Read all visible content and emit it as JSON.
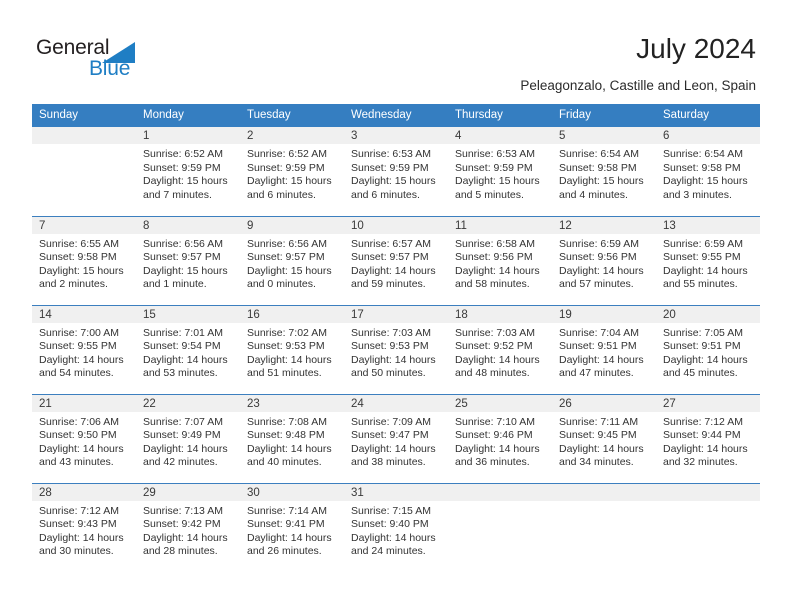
{
  "logo": {
    "word_one": "General",
    "word_two": "Blue",
    "triangle_color": "#1f7ec4"
  },
  "header": {
    "title": "July 2024",
    "subtitle": "Peleagonzalo, Castille and Leon, Spain"
  },
  "colors": {
    "header_bar": "#357ec1",
    "daynum_band": "#f0f0f0",
    "row_divider": "#3c7fbf",
    "text": "#333333"
  },
  "calendar": {
    "weekday_headers": [
      "Sunday",
      "Monday",
      "Tuesday",
      "Wednesday",
      "Thursday",
      "Friday",
      "Saturday"
    ],
    "weeks": [
      [
        {
          "day": "",
          "blank": true,
          "sunrise": "",
          "sunset": "",
          "daylight_line1": "",
          "daylight_line2": ""
        },
        {
          "day": "1",
          "sunrise": "Sunrise: 6:52 AM",
          "sunset": "Sunset: 9:59 PM",
          "daylight_line1": "Daylight: 15 hours",
          "daylight_line2": "and 7 minutes."
        },
        {
          "day": "2",
          "sunrise": "Sunrise: 6:52 AM",
          "sunset": "Sunset: 9:59 PM",
          "daylight_line1": "Daylight: 15 hours",
          "daylight_line2": "and 6 minutes."
        },
        {
          "day": "3",
          "sunrise": "Sunrise: 6:53 AM",
          "sunset": "Sunset: 9:59 PM",
          "daylight_line1": "Daylight: 15 hours",
          "daylight_line2": "and 6 minutes."
        },
        {
          "day": "4",
          "sunrise": "Sunrise: 6:53 AM",
          "sunset": "Sunset: 9:59 PM",
          "daylight_line1": "Daylight: 15 hours",
          "daylight_line2": "and 5 minutes."
        },
        {
          "day": "5",
          "sunrise": "Sunrise: 6:54 AM",
          "sunset": "Sunset: 9:58 PM",
          "daylight_line1": "Daylight: 15 hours",
          "daylight_line2": "and 4 minutes."
        },
        {
          "day": "6",
          "sunrise": "Sunrise: 6:54 AM",
          "sunset": "Sunset: 9:58 PM",
          "daylight_line1": "Daylight: 15 hours",
          "daylight_line2": "and 3 minutes."
        }
      ],
      [
        {
          "day": "7",
          "sunrise": "Sunrise: 6:55 AM",
          "sunset": "Sunset: 9:58 PM",
          "daylight_line1": "Daylight: 15 hours",
          "daylight_line2": "and 2 minutes."
        },
        {
          "day": "8",
          "sunrise": "Sunrise: 6:56 AM",
          "sunset": "Sunset: 9:57 PM",
          "daylight_line1": "Daylight: 15 hours",
          "daylight_line2": "and 1 minute."
        },
        {
          "day": "9",
          "sunrise": "Sunrise: 6:56 AM",
          "sunset": "Sunset: 9:57 PM",
          "daylight_line1": "Daylight: 15 hours",
          "daylight_line2": "and 0 minutes."
        },
        {
          "day": "10",
          "sunrise": "Sunrise: 6:57 AM",
          "sunset": "Sunset: 9:57 PM",
          "daylight_line1": "Daylight: 14 hours",
          "daylight_line2": "and 59 minutes."
        },
        {
          "day": "11",
          "sunrise": "Sunrise: 6:58 AM",
          "sunset": "Sunset: 9:56 PM",
          "daylight_line1": "Daylight: 14 hours",
          "daylight_line2": "and 58 minutes."
        },
        {
          "day": "12",
          "sunrise": "Sunrise: 6:59 AM",
          "sunset": "Sunset: 9:56 PM",
          "daylight_line1": "Daylight: 14 hours",
          "daylight_line2": "and 57 minutes."
        },
        {
          "day": "13",
          "sunrise": "Sunrise: 6:59 AM",
          "sunset": "Sunset: 9:55 PM",
          "daylight_line1": "Daylight: 14 hours",
          "daylight_line2": "and 55 minutes."
        }
      ],
      [
        {
          "day": "14",
          "sunrise": "Sunrise: 7:00 AM",
          "sunset": "Sunset: 9:55 PM",
          "daylight_line1": "Daylight: 14 hours",
          "daylight_line2": "and 54 minutes."
        },
        {
          "day": "15",
          "sunrise": "Sunrise: 7:01 AM",
          "sunset": "Sunset: 9:54 PM",
          "daylight_line1": "Daylight: 14 hours",
          "daylight_line2": "and 53 minutes."
        },
        {
          "day": "16",
          "sunrise": "Sunrise: 7:02 AM",
          "sunset": "Sunset: 9:53 PM",
          "daylight_line1": "Daylight: 14 hours",
          "daylight_line2": "and 51 minutes."
        },
        {
          "day": "17",
          "sunrise": "Sunrise: 7:03 AM",
          "sunset": "Sunset: 9:53 PM",
          "daylight_line1": "Daylight: 14 hours",
          "daylight_line2": "and 50 minutes."
        },
        {
          "day": "18",
          "sunrise": "Sunrise: 7:03 AM",
          "sunset": "Sunset: 9:52 PM",
          "daylight_line1": "Daylight: 14 hours",
          "daylight_line2": "and 48 minutes."
        },
        {
          "day": "19",
          "sunrise": "Sunrise: 7:04 AM",
          "sunset": "Sunset: 9:51 PM",
          "daylight_line1": "Daylight: 14 hours",
          "daylight_line2": "and 47 minutes."
        },
        {
          "day": "20",
          "sunrise": "Sunrise: 7:05 AM",
          "sunset": "Sunset: 9:51 PM",
          "daylight_line1": "Daylight: 14 hours",
          "daylight_line2": "and 45 minutes."
        }
      ],
      [
        {
          "day": "21",
          "sunrise": "Sunrise: 7:06 AM",
          "sunset": "Sunset: 9:50 PM",
          "daylight_line1": "Daylight: 14 hours",
          "daylight_line2": "and 43 minutes."
        },
        {
          "day": "22",
          "sunrise": "Sunrise: 7:07 AM",
          "sunset": "Sunset: 9:49 PM",
          "daylight_line1": "Daylight: 14 hours",
          "daylight_line2": "and 42 minutes."
        },
        {
          "day": "23",
          "sunrise": "Sunrise: 7:08 AM",
          "sunset": "Sunset: 9:48 PM",
          "daylight_line1": "Daylight: 14 hours",
          "daylight_line2": "and 40 minutes."
        },
        {
          "day": "24",
          "sunrise": "Sunrise: 7:09 AM",
          "sunset": "Sunset: 9:47 PM",
          "daylight_line1": "Daylight: 14 hours",
          "daylight_line2": "and 38 minutes."
        },
        {
          "day": "25",
          "sunrise": "Sunrise: 7:10 AM",
          "sunset": "Sunset: 9:46 PM",
          "daylight_line1": "Daylight: 14 hours",
          "daylight_line2": "and 36 minutes."
        },
        {
          "day": "26",
          "sunrise": "Sunrise: 7:11 AM",
          "sunset": "Sunset: 9:45 PM",
          "daylight_line1": "Daylight: 14 hours",
          "daylight_line2": "and 34 minutes."
        },
        {
          "day": "27",
          "sunrise": "Sunrise: 7:12 AM",
          "sunset": "Sunset: 9:44 PM",
          "daylight_line1": "Daylight: 14 hours",
          "daylight_line2": "and 32 minutes."
        }
      ],
      [
        {
          "day": "28",
          "sunrise": "Sunrise: 7:12 AM",
          "sunset": "Sunset: 9:43 PM",
          "daylight_line1": "Daylight: 14 hours",
          "daylight_line2": "and 30 minutes."
        },
        {
          "day": "29",
          "sunrise": "Sunrise: 7:13 AM",
          "sunset": "Sunset: 9:42 PM",
          "daylight_line1": "Daylight: 14 hours",
          "daylight_line2": "and 28 minutes."
        },
        {
          "day": "30",
          "sunrise": "Sunrise: 7:14 AM",
          "sunset": "Sunset: 9:41 PM",
          "daylight_line1": "Daylight: 14 hours",
          "daylight_line2": "and 26 minutes."
        },
        {
          "day": "31",
          "sunrise": "Sunrise: 7:15 AM",
          "sunset": "Sunset: 9:40 PM",
          "daylight_line1": "Daylight: 14 hours",
          "daylight_line2": "and 24 minutes."
        },
        {
          "day": "",
          "blank": true,
          "sunrise": "",
          "sunset": "",
          "daylight_line1": "",
          "daylight_line2": ""
        },
        {
          "day": "",
          "blank": true,
          "sunrise": "",
          "sunset": "",
          "daylight_line1": "",
          "daylight_line2": ""
        },
        {
          "day": "",
          "blank": true,
          "sunrise": "",
          "sunset": "",
          "daylight_line1": "",
          "daylight_line2": ""
        }
      ]
    ]
  }
}
